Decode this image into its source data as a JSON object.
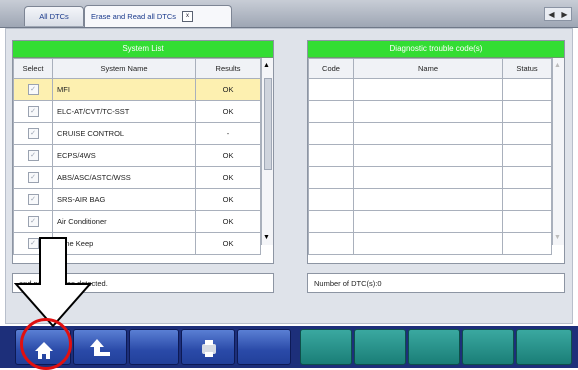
{
  "tabs": [
    {
      "label": "All DTCs"
    },
    {
      "label": "Erase and Read all DTCs",
      "close": "x"
    }
  ],
  "nav": {
    "prev": "◀",
    "next": "▶"
  },
  "system_list": {
    "title": "System List",
    "headers": {
      "select": "Select",
      "name": "System Name",
      "results": "Results"
    },
    "rows": [
      {
        "name": "MFI",
        "result": "OK"
      },
      {
        "name": "ELC-AT/CVT/TC-SST",
        "result": "OK"
      },
      {
        "name": "CRUISE CONTROL",
        "result": "-"
      },
      {
        "name": "ECPS/4WS",
        "result": "OK"
      },
      {
        "name": "ABS/ASC/ASTC/WSS",
        "result": "OK"
      },
      {
        "name": "SRS-AIR BAG",
        "result": "OK"
      },
      {
        "name": "Air Conditioner",
        "result": "OK"
      },
      {
        "name": "Lane Keep",
        "result": "OK"
      }
    ],
    "status": "and no DTC was detected."
  },
  "dtc_panel": {
    "title": "Diagnostic trouble code(s)",
    "headers": {
      "code": "Code",
      "name": "Name",
      "status": "Status"
    },
    "count_label": "Number of DTC(s):0"
  },
  "toolbar": {
    "buttons": [
      "home-icon",
      "back-icon",
      "blank",
      "print-icon",
      "blank",
      "blank",
      "blank",
      "blank",
      "blank"
    ]
  },
  "colors": {
    "header_green": "#33dd33",
    "toolbar_blue": "#1d2f7a",
    "highlight_row": "#fdf0b0",
    "annotation_red": "#e01010"
  }
}
